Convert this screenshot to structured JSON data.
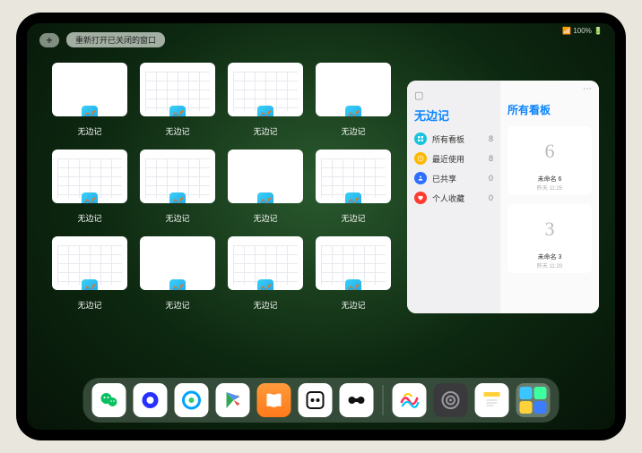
{
  "status": {
    "text": "📶 100% 🔋"
  },
  "top": {
    "plus_label": "+",
    "reopen_label": "重新打开已关闭的窗口"
  },
  "app_name": "无边记",
  "windows": [
    {
      "label": "无边记",
      "variant": "blank"
    },
    {
      "label": "无边记",
      "variant": "calendar"
    },
    {
      "label": "无边记",
      "variant": "calendar"
    },
    {
      "label": "无边记",
      "variant": "blank"
    },
    {
      "label": "无边记",
      "variant": "calendar"
    },
    {
      "label": "无边记",
      "variant": "calendar"
    },
    {
      "label": "无边记",
      "variant": "blank"
    },
    {
      "label": "无边记",
      "variant": "calendar"
    },
    {
      "label": "无边记",
      "variant": "calendar"
    },
    {
      "label": "无边记",
      "variant": "blank"
    },
    {
      "label": "无边记",
      "variant": "calendar"
    },
    {
      "label": "无边记",
      "variant": "calendar"
    }
  ],
  "panel": {
    "left_title": "无边记",
    "right_title": "所有看板",
    "more": "⋯",
    "categories": [
      {
        "icon": "grid",
        "color": "#18c3df",
        "label": "所有看板",
        "count": 8
      },
      {
        "icon": "clock",
        "color": "#ffb800",
        "label": "最近使用",
        "count": 8
      },
      {
        "icon": "share",
        "color": "#2f6eff",
        "label": "已共享",
        "count": 0
      },
      {
        "icon": "heart",
        "color": "#ff3b30",
        "label": "个人收藏",
        "count": 0
      }
    ],
    "boards": [
      {
        "glyph": "6",
        "name": "未命名 6",
        "sub": "昨天 11:25"
      },
      {
        "glyph": "3",
        "name": "未命名 3",
        "sub": "昨天 11:20"
      }
    ]
  },
  "dock": {
    "items": [
      {
        "name": "wechat",
        "bg": "#ffffff"
      },
      {
        "name": "quark",
        "bg": "#ffffff"
      },
      {
        "name": "qqbrowser",
        "bg": "#ffffff"
      },
      {
        "name": "play",
        "bg": "#ffffff"
      },
      {
        "name": "books",
        "bg": "linear-gradient(#ff9a3c,#ff7a1a)"
      },
      {
        "name": "dots",
        "bg": "#ffffff"
      },
      {
        "name": "dumbbell",
        "bg": "#ffffff"
      }
    ],
    "recent": [
      {
        "name": "freeform",
        "bg": "#ffffff"
      },
      {
        "name": "settings",
        "bg": "#3a3a3c"
      },
      {
        "name": "notes",
        "bg": "#ffffff"
      }
    ],
    "folder_colors": [
      "#3cc6ff",
      "#3cff9e",
      "#ffd23c",
      "#3c7dff"
    ]
  }
}
